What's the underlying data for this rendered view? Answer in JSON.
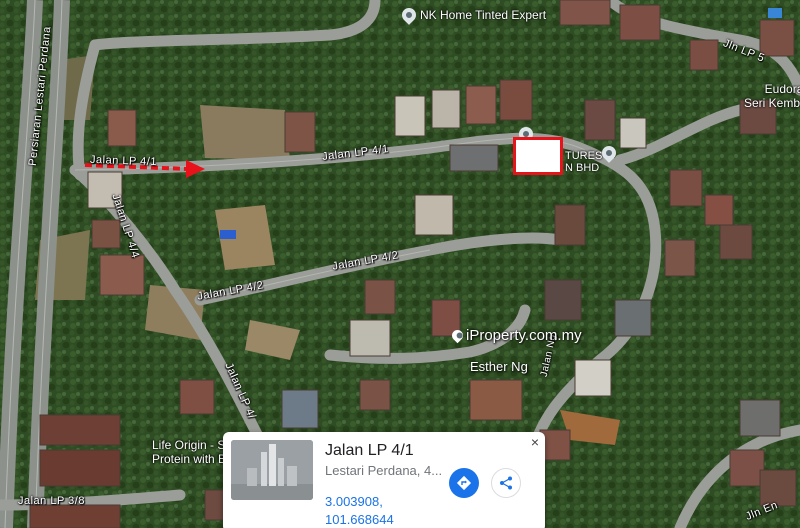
{
  "map": {
    "roads": {
      "lp41_main": "Jalan LP 4/1",
      "lp41_west": "Jalan LP 4/1",
      "lp42_main": "Jalan LP 4/2",
      "lp42_west": "Jalan LP 4/2",
      "lp44": "Jalan LP 4/4",
      "lp43": "Jalan LP 4/",
      "lp38": "Jalan LP 3/8",
      "lp5": "Jln LP 5",
      "persiaran": "Persiaran Lestari Perdana",
      "ng": "Jalan Ng",
      "en": "Jln En"
    },
    "pois": {
      "nk_home": "NK Home Tinted Expert",
      "eudora_line1": "EudoraPlace",
      "eudora_line2": "Seri Kembangan",
      "partial_line1": "TURES",
      "partial_line2": "N BHD",
      "life_origin_line1": "Life Origin - S",
      "life_origin_line2": "Protein with B"
    },
    "watermark": "iProperty.com.my",
    "agent": "Esther Ng"
  },
  "card": {
    "title": "Jalan LP 4/1",
    "subtitle": "Lestari Perdana, 4...",
    "lat": "3.003908,",
    "lng": "101.668644",
    "close": "×"
  },
  "colors": {
    "marker": "#e8121a",
    "accent": "#1a73e8"
  },
  "icons": [
    "location-pin-icon",
    "directions-icon",
    "share-icon",
    "close-icon",
    "red-arrow-icon"
  ]
}
